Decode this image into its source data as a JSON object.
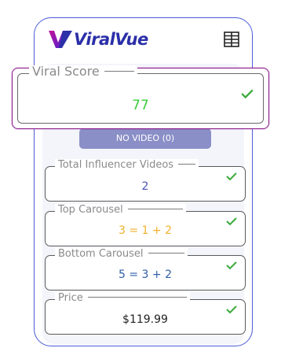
{
  "app": {
    "brand": "ViralVue",
    "brand_color": "#2b2fa8",
    "logo_gradient": [
      "#c4129a",
      "#4a1fd1"
    ],
    "menu_icon": "table-menu-icon"
  },
  "viral_score": {
    "label": "Viral Score",
    "value": "77",
    "value_color": "#3dcc3d",
    "status_icon": "check-icon"
  },
  "no_video_button": {
    "label": "NO VIDEO  (0)"
  },
  "fields": [
    {
      "label": "Total Influencer Videos",
      "value": "2",
      "value_color": "#4b56b5",
      "status_icon": "check-icon"
    },
    {
      "label": "Top Carousel",
      "value": "3 = 1 + 2",
      "value_color": "#f0b12c",
      "status_icon": "check-icon"
    },
    {
      "label": "Bottom Carousel",
      "value": "5 = 3 + 2",
      "value_color": "#2f5fa8",
      "status_icon": "check-icon"
    },
    {
      "label": "Price",
      "value": "$119.99",
      "value_color": "#222222",
      "status_icon": "check-icon"
    }
  ],
  "colors": {
    "check": "#3caa3c",
    "phone_border": "#4a5bd8",
    "highlight_border": "#8a1a8a"
  }
}
